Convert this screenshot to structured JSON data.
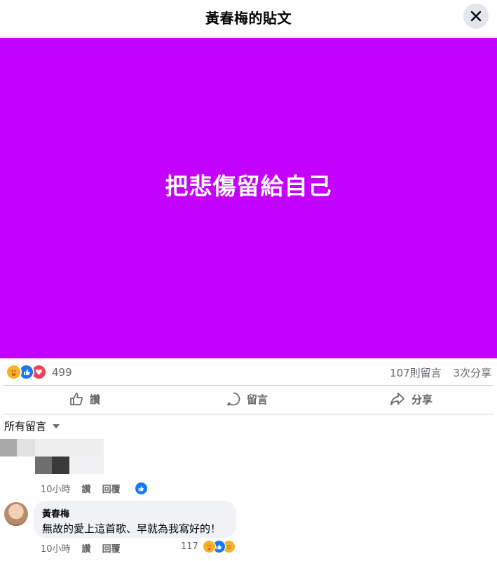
{
  "header": {
    "title": "黃春梅的貼文"
  },
  "post": {
    "text": "把悲傷留給自己",
    "background_color": "#c400ff"
  },
  "stats": {
    "reaction_count": "499",
    "comments": "107則留言",
    "shares": "3次分享",
    "reaction_icons": [
      "care-icon",
      "like-icon",
      "love-icon"
    ]
  },
  "actions": {
    "like": "讚",
    "comment": "留言",
    "share": "分享"
  },
  "comments_sort": {
    "label": "所有留言"
  },
  "comments": [
    {
      "time": "10小時",
      "like_label": "讚",
      "reply_label": "回覆",
      "reaction_icons": [
        "like-icon"
      ]
    },
    {
      "author": "黃春梅",
      "text": "無故的愛上這首歌、早就為我寫好的！",
      "time": "10小時",
      "like_label": "讚",
      "reply_label": "回覆",
      "reaction_count": "117",
      "reaction_icons": [
        "care-icon",
        "like-icon",
        "sad-icon"
      ]
    }
  ]
}
